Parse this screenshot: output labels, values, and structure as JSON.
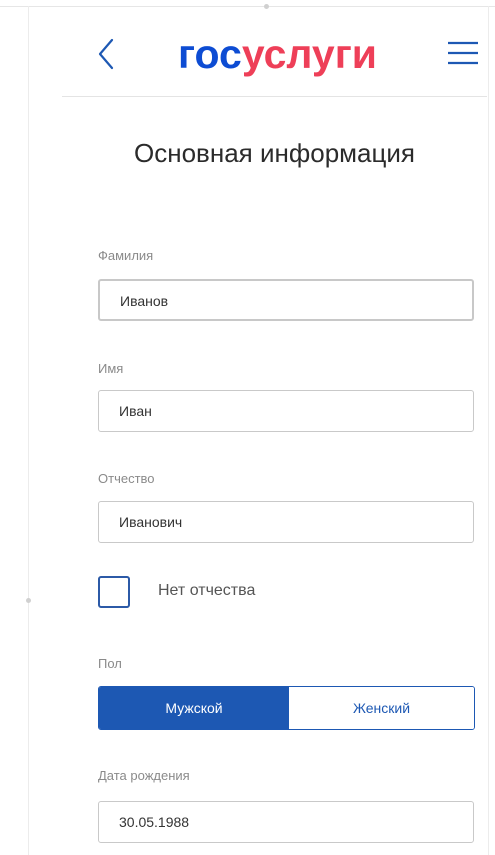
{
  "header": {
    "logo_part1": "гос",
    "logo_part2": "услуги"
  },
  "page": {
    "title": "Основная информация"
  },
  "form": {
    "last_name": {
      "label": "Фамилия",
      "value": "Иванов"
    },
    "first_name": {
      "label": "Имя",
      "value": "Иван"
    },
    "patronymic": {
      "label": "Отчество",
      "value": "Иванович"
    },
    "no_patronymic": {
      "label": "Нет отчества",
      "checked": false
    },
    "gender": {
      "label": "Пол",
      "options": [
        "Мужской",
        "Женский"
      ],
      "selected": "Мужской"
    },
    "birth_date": {
      "label": "Дата рождения",
      "value": "30.05.1988"
    }
  },
  "colors": {
    "brand_blue": "#0d4cd3",
    "brand_red": "#ee3f58",
    "accent": "#1d58b3"
  },
  "icons": [
    "back-arrow-icon",
    "hamburger-menu-icon"
  ]
}
